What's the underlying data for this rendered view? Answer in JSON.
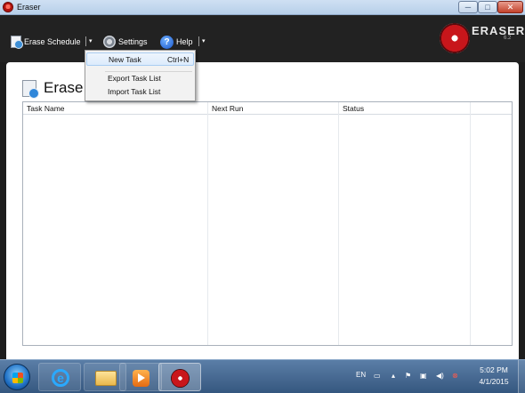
{
  "window": {
    "title": "Eraser",
    "min_label": "─",
    "max_label": "□",
    "close_label": "✕"
  },
  "toolbar": {
    "erase_schedule": "Erase Schedule",
    "settings": "Settings",
    "help": "Help",
    "help_glyph": "?",
    "dropdown_glyph": "▾",
    "brand": "ERASER",
    "version": "6.2"
  },
  "page": {
    "heading": "Erase"
  },
  "table": {
    "columns": [
      "Task Name",
      "Next Run",
      "Status"
    ],
    "rows": []
  },
  "menu": {
    "items": [
      {
        "label": "New Task",
        "shortcut": "Ctrl+N"
      },
      {
        "label": "Export Task List"
      },
      {
        "label": "Import Task List"
      }
    ]
  },
  "taskbar": {
    "apps": [
      "internet-explorer",
      "file-explorer",
      "media-player",
      "eraser"
    ],
    "ie_glyph": "e",
    "language": "EN",
    "time": "5:02 PM",
    "date": "4/1/2015"
  },
  "colors": {
    "brand_red": "#c8161b",
    "toolbar_bg": "#222222",
    "taskbar_bg": "#35577f",
    "menu_highlight": "#dcebfc"
  }
}
